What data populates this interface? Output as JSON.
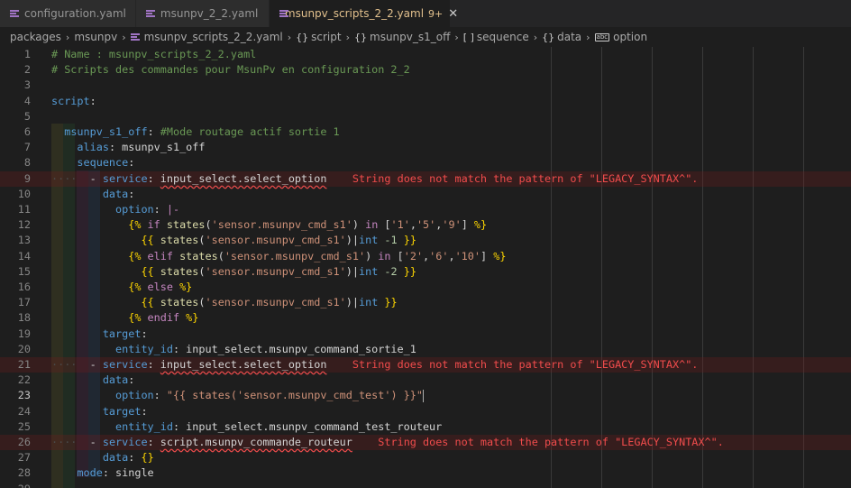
{
  "tabs": [
    {
      "label": "configuration.yaml",
      "active": false
    },
    {
      "label": "msunpv_2_2.yaml",
      "active": false
    },
    {
      "label": "msunpv_scripts_2_2.yaml",
      "active": true,
      "badge": "9+",
      "close": "✕"
    }
  ],
  "breadcrumb": {
    "packages": "packages",
    "msunpv": "msunpv",
    "file": "msunpv_scripts_2_2.yaml",
    "script": "script",
    "entry": "msunpv_s1_off",
    "sequence": "sequence",
    "data": "data",
    "option": "option",
    "sep": "›",
    "obj_sym": "{}",
    "arr_sym": "[ ]",
    "str_sym": "abc"
  },
  "editor": {
    "line_numbers": [
      "1",
      "2",
      "3",
      "4",
      "5",
      "6",
      "7",
      "8",
      "9",
      "10",
      "11",
      "12",
      "13",
      "14",
      "15",
      "16",
      "17",
      "18",
      "19",
      "20",
      "21",
      "22",
      "23",
      "24",
      "25",
      "26",
      "27",
      "28",
      "29"
    ],
    "current_line": "23",
    "error_message": "String does not match the pattern of \"LEGACY_SYNTAX^\".",
    "lines": [
      {
        "t": [
          [
            "c-com",
            "# Name : msunpv_scripts_2_2.yaml"
          ]
        ]
      },
      {
        "t": [
          [
            "c-com",
            "# Scripts des commandes pour MsunPv en configuration 2_2"
          ]
        ]
      },
      {
        "t": []
      },
      {
        "t": [
          [
            "c-key",
            "script"
          ],
          [
            "c-pl",
            ":"
          ]
        ]
      },
      {
        "t": []
      },
      {
        "t": [
          [
            "c-pl",
            "  "
          ],
          [
            "c-key",
            "msunpv_s1_off"
          ],
          [
            "c-pl",
            ": "
          ],
          [
            "c-com",
            "#Mode routage actif sortie 1"
          ]
        ]
      },
      {
        "t": [
          [
            "c-pl",
            "    "
          ],
          [
            "c-key",
            "alias"
          ],
          [
            "c-pl",
            ": msunpv_s1_off"
          ]
        ]
      },
      {
        "t": [
          [
            "c-pl",
            "    "
          ],
          [
            "c-key",
            "sequence"
          ],
          [
            "c-pl",
            ":"
          ]
        ]
      },
      {
        "err": true,
        "t": [
          [
            "c-dot",
            "····"
          ],
          [
            "c-pl",
            "  - "
          ],
          [
            "c-key",
            "service"
          ],
          [
            "c-pl",
            ": "
          ],
          [
            "c-lnk",
            "input_select.select_option"
          ],
          [
            "c-pl",
            "    "
          ],
          [
            "c-err",
            "String does not match the pattern of \"LEGACY_SYNTAX^\"."
          ]
        ]
      },
      {
        "t": [
          [
            "c-pl",
            "        "
          ],
          [
            "c-key",
            "data"
          ],
          [
            "c-pl",
            ":"
          ]
        ]
      },
      {
        "t": [
          [
            "c-pl",
            "          "
          ],
          [
            "c-key",
            "option"
          ],
          [
            "c-pl",
            ": "
          ],
          [
            "c-kw",
            "|-"
          ]
        ]
      },
      {
        "t": [
          [
            "c-pl",
            "            "
          ],
          [
            "c-tpl",
            "{%"
          ],
          [
            "c-kw",
            " if "
          ],
          [
            "c-fn",
            "states"
          ],
          [
            "c-pl",
            "("
          ],
          [
            "c-str",
            "'sensor.msunpv_cmd_s1'"
          ],
          [
            "c-pl",
            ") "
          ],
          [
            "c-kw",
            "in"
          ],
          [
            "c-pl",
            " ["
          ],
          [
            "c-str",
            "'1'"
          ],
          [
            "c-pl",
            ","
          ],
          [
            "c-str",
            "'5'"
          ],
          [
            "c-pl",
            ","
          ],
          [
            "c-str",
            "'9'"
          ],
          [
            "c-pl",
            "] "
          ],
          [
            "c-tpl",
            "%}"
          ]
        ]
      },
      {
        "t": [
          [
            "c-pl",
            "              "
          ],
          [
            "c-tpl",
            "{{"
          ],
          [
            "c-pl",
            " "
          ],
          [
            "c-fn",
            "states"
          ],
          [
            "c-pl",
            "("
          ],
          [
            "c-str",
            "'sensor.msunpv_cmd_s1'"
          ],
          [
            "c-pl",
            ")|"
          ],
          [
            "c-key",
            "int"
          ],
          [
            "c-pl",
            " "
          ],
          [
            "c-num",
            "-1"
          ],
          [
            "c-pl",
            " "
          ],
          [
            "c-tpl",
            "}}"
          ]
        ]
      },
      {
        "t": [
          [
            "c-pl",
            "            "
          ],
          [
            "c-tpl",
            "{%"
          ],
          [
            "c-kw",
            " elif "
          ],
          [
            "c-fn",
            "states"
          ],
          [
            "c-pl",
            "("
          ],
          [
            "c-str",
            "'sensor.msunpv_cmd_s1'"
          ],
          [
            "c-pl",
            ") "
          ],
          [
            "c-kw",
            "in"
          ],
          [
            "c-pl",
            " ["
          ],
          [
            "c-str",
            "'2'"
          ],
          [
            "c-pl",
            ","
          ],
          [
            "c-str",
            "'6'"
          ],
          [
            "c-pl",
            ","
          ],
          [
            "c-str",
            "'10'"
          ],
          [
            "c-pl",
            "] "
          ],
          [
            "c-tpl",
            "%}"
          ]
        ]
      },
      {
        "t": [
          [
            "c-pl",
            "              "
          ],
          [
            "c-tpl",
            "{{"
          ],
          [
            "c-pl",
            " "
          ],
          [
            "c-fn",
            "states"
          ],
          [
            "c-pl",
            "("
          ],
          [
            "c-str",
            "'sensor.msunpv_cmd_s1'"
          ],
          [
            "c-pl",
            ")|"
          ],
          [
            "c-key",
            "int"
          ],
          [
            "c-pl",
            " "
          ],
          [
            "c-num",
            "-2"
          ],
          [
            "c-pl",
            " "
          ],
          [
            "c-tpl",
            "}}"
          ]
        ]
      },
      {
        "t": [
          [
            "c-pl",
            "            "
          ],
          [
            "c-tpl",
            "{%"
          ],
          [
            "c-kw",
            " else "
          ],
          [
            "c-tpl",
            "%}"
          ]
        ]
      },
      {
        "t": [
          [
            "c-pl",
            "              "
          ],
          [
            "c-tpl",
            "{{"
          ],
          [
            "c-pl",
            " "
          ],
          [
            "c-fn",
            "states"
          ],
          [
            "c-pl",
            "("
          ],
          [
            "c-str",
            "'sensor.msunpv_cmd_s1'"
          ],
          [
            "c-pl",
            ")|"
          ],
          [
            "c-key",
            "int"
          ],
          [
            "c-pl",
            " "
          ],
          [
            "c-tpl",
            "}}"
          ]
        ]
      },
      {
        "t": [
          [
            "c-pl",
            "            "
          ],
          [
            "c-tpl",
            "{%"
          ],
          [
            "c-kw",
            " endif "
          ],
          [
            "c-tpl",
            "%}"
          ]
        ]
      },
      {
        "t": [
          [
            "c-pl",
            "        "
          ],
          [
            "c-key",
            "target"
          ],
          [
            "c-pl",
            ":"
          ]
        ]
      },
      {
        "t": [
          [
            "c-pl",
            "          "
          ],
          [
            "c-key",
            "entity_id"
          ],
          [
            "c-pl",
            ": input_select.msunpv_command_sortie_1"
          ]
        ]
      },
      {
        "err": true,
        "t": [
          [
            "c-dot",
            "····"
          ],
          [
            "c-pl",
            "  - "
          ],
          [
            "c-key",
            "service"
          ],
          [
            "c-pl",
            ": "
          ],
          [
            "c-lnk",
            "input_select.select_option"
          ],
          [
            "c-pl",
            "    "
          ],
          [
            "c-err",
            "String does not match the pattern of \"LEGACY_SYNTAX^\"."
          ]
        ]
      },
      {
        "t": [
          [
            "c-pl",
            "        "
          ],
          [
            "c-key",
            "data"
          ],
          [
            "c-pl",
            ":"
          ]
        ]
      },
      {
        "cursor": true,
        "t": [
          [
            "c-pl",
            "          "
          ],
          [
            "c-key",
            "option"
          ],
          [
            "c-pl",
            ": "
          ],
          [
            "c-str",
            "\"{{ states('sensor.msunpv_cmd_test') }}\""
          ]
        ]
      },
      {
        "t": [
          [
            "c-pl",
            "        "
          ],
          [
            "c-key",
            "target"
          ],
          [
            "c-pl",
            ":"
          ]
        ]
      },
      {
        "t": [
          [
            "c-pl",
            "          "
          ],
          [
            "c-key",
            "entity_id"
          ],
          [
            "c-pl",
            ": input_select.msunpv_command_test_routeur"
          ]
        ]
      },
      {
        "err": true,
        "t": [
          [
            "c-dot",
            "····"
          ],
          [
            "c-pl",
            "  - "
          ],
          [
            "c-key",
            "service"
          ],
          [
            "c-pl",
            ": "
          ],
          [
            "c-lnk",
            "script.msunpv_commande_routeur"
          ],
          [
            "c-pl",
            "    "
          ],
          [
            "c-err",
            "String does not match the pattern of \"LEGACY_SYNTAX^\"."
          ]
        ]
      },
      {
        "t": [
          [
            "c-pl",
            "        "
          ],
          [
            "c-key",
            "data"
          ],
          [
            "c-pl",
            ": "
          ],
          [
            "c-tpl",
            "{}"
          ]
        ]
      },
      {
        "t": [
          [
            "c-pl",
            "    "
          ],
          [
            "c-key",
            "mode"
          ],
          [
            "c-pl",
            ": single"
          ]
        ]
      },
      {
        "t": [
          [
            "c-dot",
            "····"
          ]
        ]
      }
    ]
  },
  "colors": {
    "accent_tab": "#e2c08d",
    "error": "#f14c4c",
    "yaml_icon": "#a074c4"
  }
}
